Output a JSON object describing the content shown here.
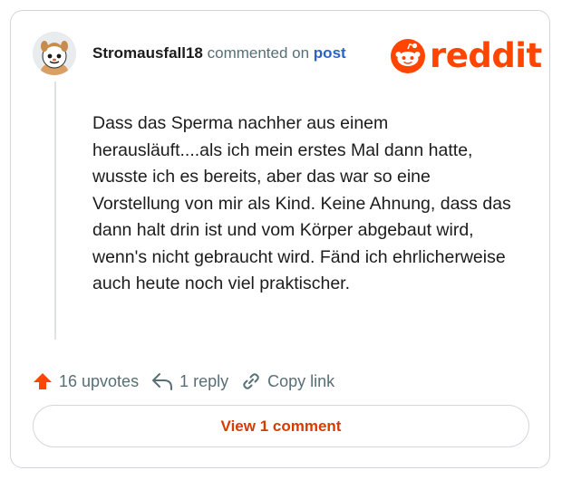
{
  "comment": {
    "username": "Stromausfall18",
    "action_text": " commented on ",
    "post_link": "post",
    "body": "Dass das Sperma nachher aus einem herausläuft....als ich mein erstes Mal dann hatte, wusste ich es bereits, aber das war so eine Vorstellung von mir als Kind. Keine Ahnung, dass das dann halt drin ist und vom Körper abgebaut wird, wenn's nicht gebraucht wird. Fänd ich ehrlicherweise auch heute noch viel praktischer."
  },
  "brand": {
    "wordmark": "reddit",
    "color": "#ff4500"
  },
  "actions": {
    "upvotes": "16 upvotes",
    "reply": "1 reply",
    "copy_link": "Copy link"
  },
  "view_comments_label": "View 1 comment",
  "icons": {
    "avatar": "snoo-avatar",
    "logo": "reddit-snoo-icon",
    "upvote": "upvote-arrow-icon",
    "reply": "reply-arrow-icon",
    "copy": "link-icon"
  }
}
